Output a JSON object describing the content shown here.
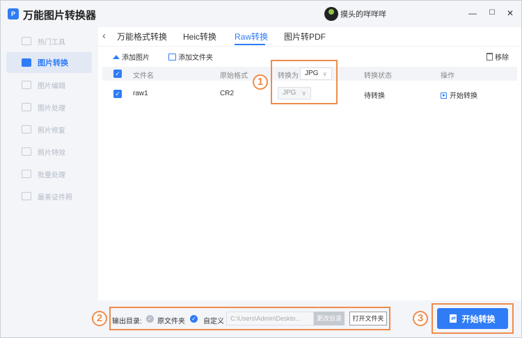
{
  "app": {
    "title": "万能图片转换器",
    "logo_text": "P",
    "user_name": "摸头的咩咩咩"
  },
  "window_controls": {
    "minimize": "—",
    "maximize": "☐",
    "close": "✕"
  },
  "sidebar": {
    "items": [
      {
        "label": "热门工具"
      },
      {
        "label": "图片转换",
        "active": true
      },
      {
        "label": "图片编辑"
      },
      {
        "label": "图片处理"
      },
      {
        "label": "照片修复"
      },
      {
        "label": "照片特效"
      },
      {
        "label": "批量处理"
      },
      {
        "label": "最美证件照"
      }
    ]
  },
  "tabs": {
    "back": "‹",
    "items": [
      {
        "label": "万能格式转换"
      },
      {
        "label": "Heic转换"
      },
      {
        "label": "Raw转换",
        "active": true
      },
      {
        "label": "图片转PDF"
      }
    ]
  },
  "toolbar": {
    "add_image": "添加图片",
    "add_folder": "添加文件夹",
    "remove": "移除"
  },
  "table": {
    "headers": {
      "filename": "文件名",
      "original_format": "原始格式",
      "convert_to": "转换为",
      "status": "转换状态",
      "action": "操作"
    },
    "global_format": "JPG",
    "rows": [
      {
        "filename": "raw1",
        "original_format": "CR2",
        "format": "JPG",
        "status": "待转换",
        "action": "开始转换"
      }
    ]
  },
  "bottom": {
    "output_label": "输出目录:",
    "option_original": "原文件夹",
    "option_custom": "自定义",
    "path": "C:\\Users\\Admin\\Deskto...",
    "change_dir": "更改目录",
    "open_folder": "打开文件夹",
    "start": "开始转换"
  },
  "annotations": {
    "one": "1",
    "two": "2",
    "three": "3",
    "color": "#ee8c4a"
  },
  "colors": {
    "accent": "#2f7cf6"
  }
}
